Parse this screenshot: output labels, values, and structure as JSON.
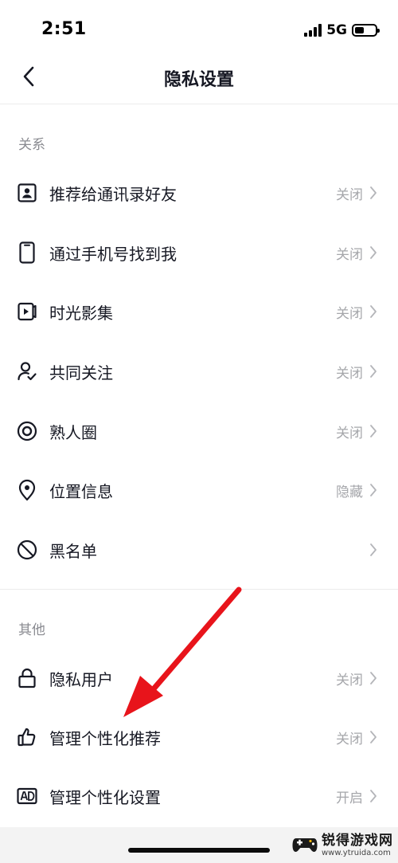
{
  "status_bar": {
    "time": "2:51",
    "network": "5G",
    "battery_level": 0.45
  },
  "nav": {
    "title": "隐私设置",
    "back_icon": "chevron-left-icon"
  },
  "sections": [
    {
      "header": "关系",
      "items": [
        {
          "label": "推荐给通讯录好友",
          "value": "关闭",
          "icon": "contact-card-icon"
        },
        {
          "label": "通过手机号找到我",
          "value": "关闭",
          "icon": "phone-icon"
        },
        {
          "label": "时光影集",
          "value": "关闭",
          "icon": "video-album-icon"
        },
        {
          "label": "共同关注",
          "value": "关闭",
          "icon": "user-check-icon"
        },
        {
          "label": "熟人圈",
          "value": "关闭",
          "icon": "target-circle-icon"
        },
        {
          "label": "位置信息",
          "value": "隐藏",
          "icon": "location-pin-icon"
        },
        {
          "label": "黑名单",
          "value": "",
          "icon": "block-icon"
        }
      ]
    },
    {
      "header": "其他",
      "items": [
        {
          "label": "隐私用户",
          "value": "关闭",
          "icon": "lock-icon"
        },
        {
          "label": "管理个性化推荐",
          "value": "关闭",
          "icon": "thumbs-up-icon"
        },
        {
          "label": "管理个性化设置",
          "value": "开启",
          "icon": "ad-badge-icon"
        }
      ]
    }
  ],
  "watermark": {
    "brand": "锐得游戏网",
    "url": "www.ytruida.com"
  },
  "colors": {
    "text_primary": "#161823",
    "text_secondary": "#8a8b91",
    "value_text": "#a6a7ab",
    "annotation_arrow": "#e8141b"
  }
}
